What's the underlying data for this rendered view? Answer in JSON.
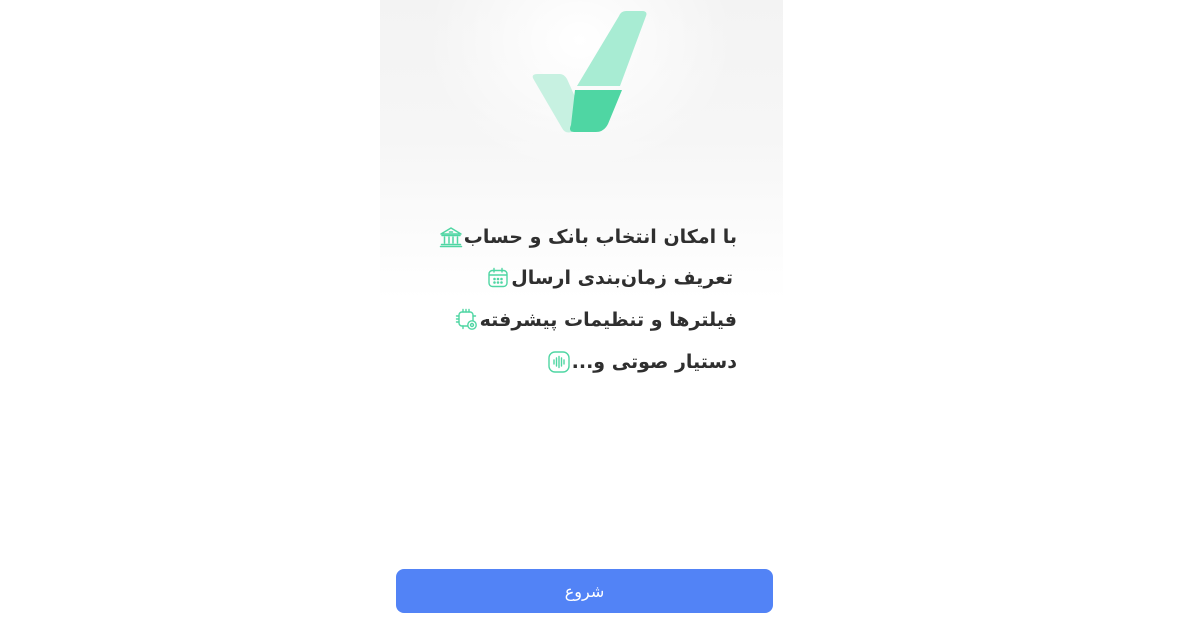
{
  "features": [
    {
      "icon": "bank-icon",
      "text": "با امکان انتخاب بانک و حساب"
    },
    {
      "icon": "calendar-icon",
      "text": "تعریف زمان‌بندی ارسال"
    },
    {
      "icon": "settings-chip-icon",
      "text": "فیلترها و تنظیمات پیشرفته"
    },
    {
      "icon": "voice-waveform-icon",
      "text": "دستیار صوتی و..."
    }
  ],
  "start_button": {
    "label": "شروع"
  },
  "colors": {
    "accent_green": "#4fd6a3",
    "light_green": "#a8ecd3",
    "button_blue": "#5283f6",
    "text": "#2f2f2f"
  }
}
